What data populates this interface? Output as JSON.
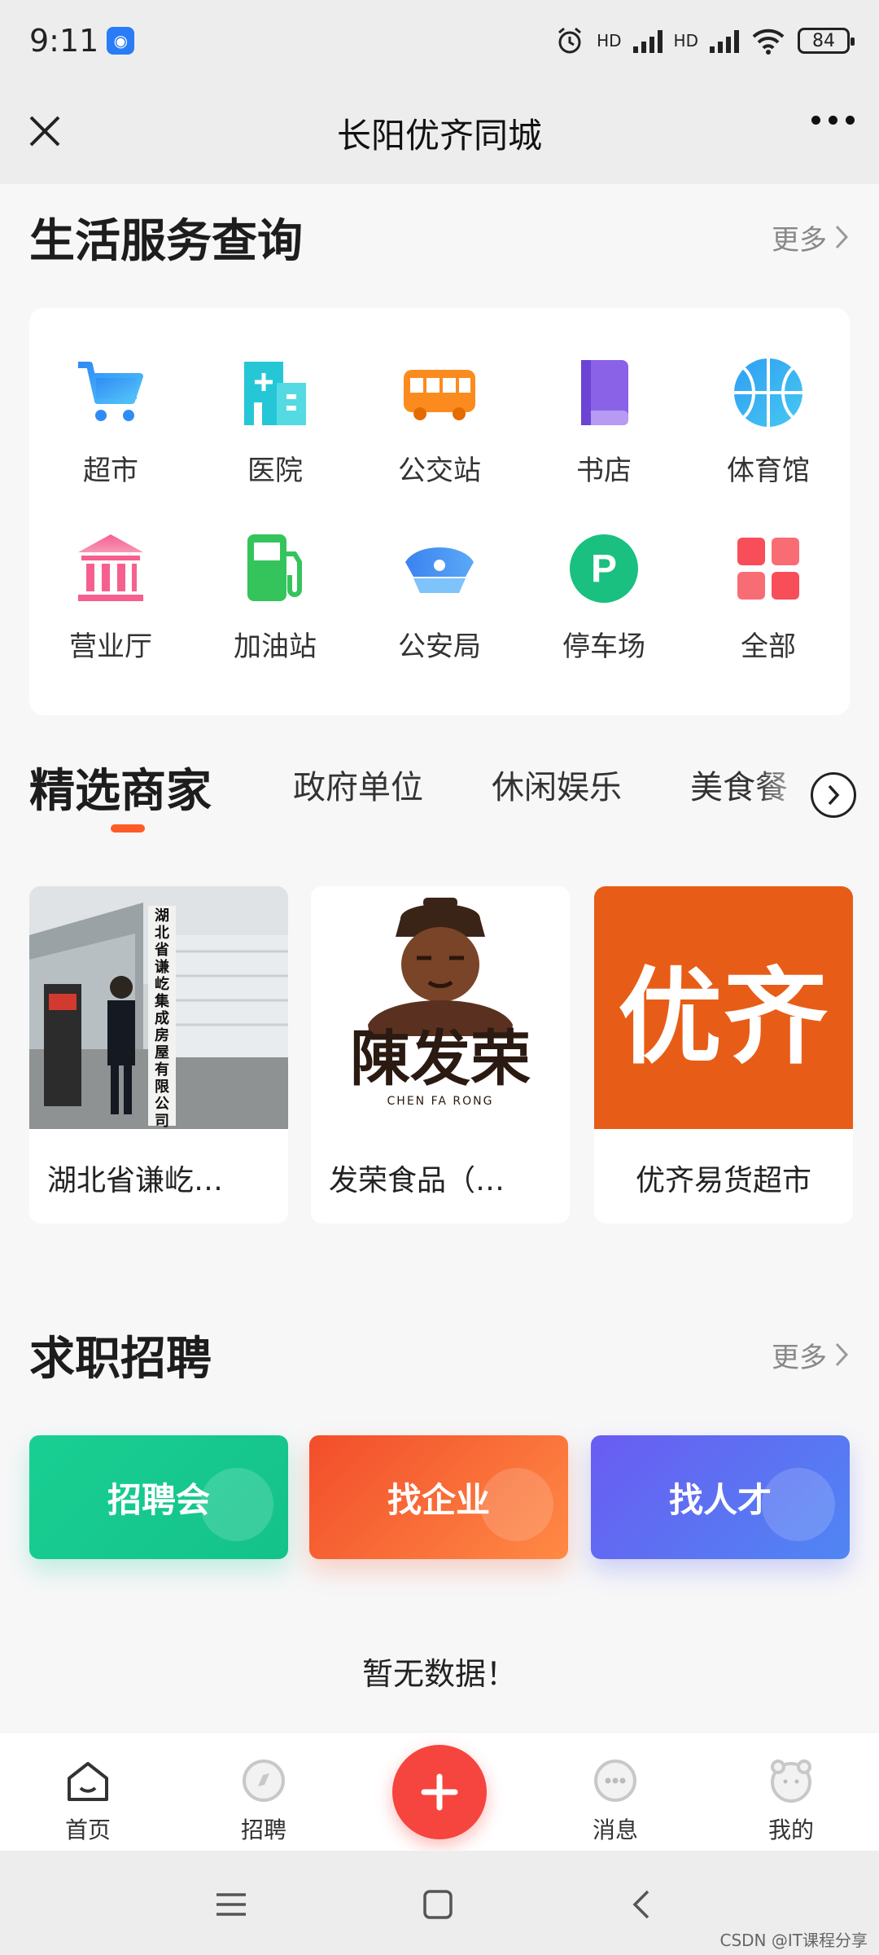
{
  "status_bar": {
    "time": "9:11",
    "battery": "84",
    "network_label": "HD"
  },
  "header": {
    "title": "长阳优齐同城"
  },
  "life_services": {
    "heading": "生活服务查询",
    "more": "更多",
    "items": [
      {
        "label": "超市",
        "icon": "cart-icon"
      },
      {
        "label": "医院",
        "icon": "hospital-icon"
      },
      {
        "label": "公交站",
        "icon": "bus-icon"
      },
      {
        "label": "书店",
        "icon": "book-icon"
      },
      {
        "label": "体育馆",
        "icon": "basketball-icon"
      },
      {
        "label": "营业厅",
        "icon": "bank-icon"
      },
      {
        "label": "加油站",
        "icon": "gas-pump-icon"
      },
      {
        "label": "公安局",
        "icon": "police-cap-icon"
      },
      {
        "label": "停车场",
        "icon": "parking-icon"
      },
      {
        "label": "全部",
        "icon": "grid-icon"
      }
    ]
  },
  "merchants": {
    "tabs": [
      "精选商家",
      "政府单位",
      "休闲娱乐",
      "美食餐"
    ],
    "cards": [
      {
        "name": "湖北省谦屹…",
        "sign_text": "湖北省谦屹集成房屋有限公司"
      },
      {
        "name": "发荣食品（…",
        "logo_text": "陳发荣",
        "logo_sub": "CHEN FA RONG"
      },
      {
        "name": "优齐易货超市",
        "logo_text": "优齐"
      }
    ]
  },
  "jobs": {
    "heading": "求职招聘",
    "more": "更多",
    "buttons": [
      "招聘会",
      "找企业",
      "找人才"
    ],
    "empty": "暂无数据！"
  },
  "tab_bar": {
    "items": [
      {
        "label": "首页",
        "icon": "home-icon"
      },
      {
        "label": "招聘",
        "icon": "compass-icon"
      },
      {
        "label": "消息",
        "icon": "message-icon"
      },
      {
        "label": "我的",
        "icon": "profile-icon"
      }
    ]
  },
  "watermark": "CSDN @IT课程分享",
  "colors": {
    "accent": "#ff5a2a",
    "fab": "#f5453e",
    "job_green": "#17c98a",
    "job_orange": "#f5582e",
    "job_blue": "#5a63f2"
  }
}
